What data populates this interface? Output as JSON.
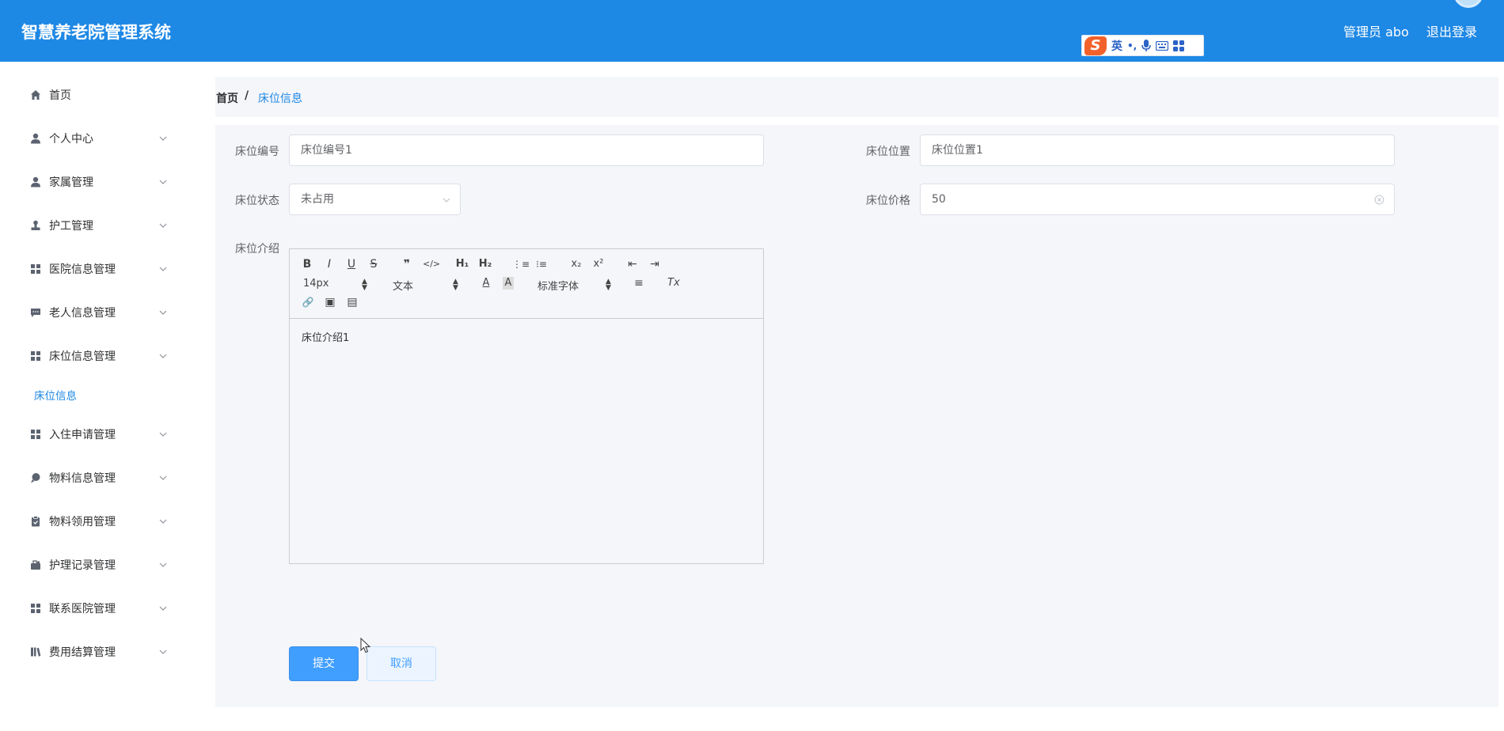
{
  "header": {
    "app_title": "智慧养老院管理系统",
    "user_label": "管理员 abo",
    "logout_label": "退出登录",
    "ime": {
      "logo": "S",
      "lang": "英",
      "punct": "•,",
      "mic": "🎙",
      "keyboard": "⌨",
      "grid": "▦"
    }
  },
  "sidebar": {
    "items": [
      {
        "label": "首页",
        "icon": "home-icon",
        "expandable": false
      },
      {
        "label": "个人中心",
        "icon": "user-icon",
        "expandable": true
      },
      {
        "label": "家属管理",
        "icon": "user-icon",
        "expandable": true
      },
      {
        "label": "护工管理",
        "icon": "stamp-icon",
        "expandable": true
      },
      {
        "label": "医院信息管理",
        "icon": "grid-icon",
        "expandable": true
      },
      {
        "label": "老人信息管理",
        "icon": "chat-icon",
        "expandable": true
      },
      {
        "label": "床位信息管理",
        "icon": "grid-icon",
        "expandable": true
      },
      {
        "label": "入住申请管理",
        "icon": "grid-icon",
        "expandable": true
      },
      {
        "label": "物料信息管理",
        "icon": "pin-icon",
        "expandable": true
      },
      {
        "label": "物料领用管理",
        "icon": "clipboard-icon",
        "expandable": true
      },
      {
        "label": "护理记录管理",
        "icon": "briefcase-icon",
        "expandable": true
      },
      {
        "label": "联系医院管理",
        "icon": "grid-icon",
        "expandable": true
      },
      {
        "label": "费用结算管理",
        "icon": "book-icon",
        "expandable": true
      }
    ],
    "sub_item": "床位信息"
  },
  "breadcrumb": {
    "home": "首页",
    "separator": "/",
    "current": "床位信息"
  },
  "form": {
    "bed_no": {
      "label": "床位编号",
      "value": "床位编号1"
    },
    "bed_location": {
      "label": "床位位置",
      "value": "床位位置1"
    },
    "bed_status": {
      "label": "床位状态",
      "value": "未占用"
    },
    "bed_price": {
      "label": "床位价格",
      "value": "50"
    },
    "bed_intro": {
      "label": "床位介绍",
      "content": "床位介绍1"
    }
  },
  "editor": {
    "bold": "B",
    "italic": "I",
    "underline": "U",
    "strike": "S",
    "quote": "❞",
    "code": "</>",
    "h1": "H₁",
    "h2": "H₂",
    "ordered": "⋮≡",
    "bullet": "⁝≡",
    "sub": "x₂",
    "sup": "x²",
    "outdent": "⇤",
    "indent": "⇥",
    "font_size": "14px",
    "block_type": "文本",
    "font_family": "标准字体",
    "color": "A",
    "background": "A",
    "align": "≡",
    "clean": "Tx",
    "link": "🔗",
    "image": "▣",
    "video": "▤"
  },
  "actions": {
    "submit": "提交",
    "cancel": "取消"
  }
}
